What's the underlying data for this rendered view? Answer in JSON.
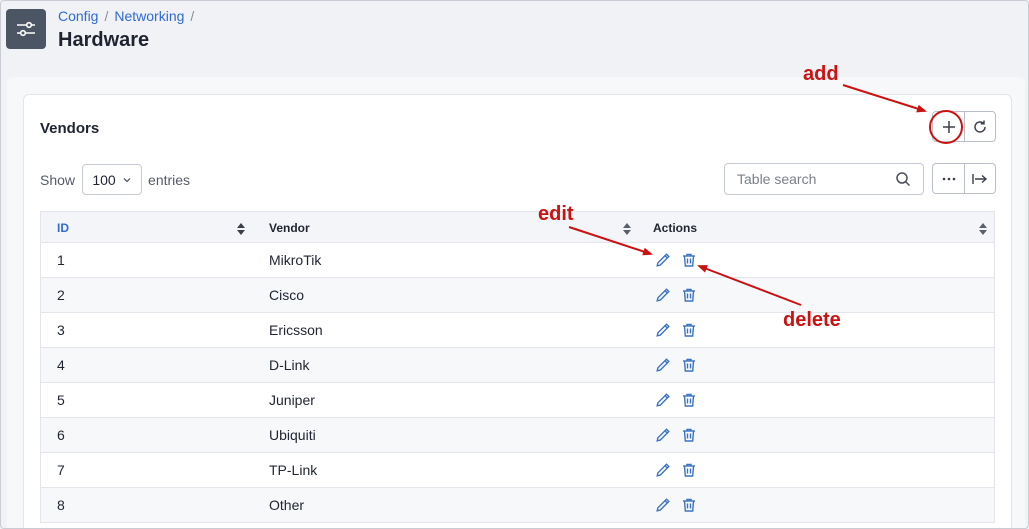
{
  "breadcrumb": {
    "item1": "Config",
    "sep1": "/",
    "item2": "Networking",
    "sep2": "/"
  },
  "page": {
    "title": "Hardware",
    "icon": "sliders-icon"
  },
  "card": {
    "title": "Vendors"
  },
  "toolbar": {
    "add_icon": "plus-icon",
    "refresh_icon": "refresh-icon",
    "more_icon": "ellipsis-icon",
    "export_icon": "arrow-to-right-icon"
  },
  "entries": {
    "show_label": "Show",
    "value": "100",
    "suffix": "entries"
  },
  "search": {
    "placeholder": "Table search"
  },
  "table": {
    "headers": {
      "id": "ID",
      "vendor": "Vendor",
      "actions": "Actions"
    },
    "rows": [
      {
        "id": "1",
        "vendor": "MikroTik"
      },
      {
        "id": "2",
        "vendor": "Cisco"
      },
      {
        "id": "3",
        "vendor": "Ericsson"
      },
      {
        "id": "4",
        "vendor": "D-Link"
      },
      {
        "id": "5",
        "vendor": "Juniper"
      },
      {
        "id": "6",
        "vendor": "Ubiquiti"
      },
      {
        "id": "7",
        "vendor": "TP-Link"
      },
      {
        "id": "8",
        "vendor": "Other"
      }
    ]
  },
  "annotations": {
    "add": "add",
    "edit": "edit",
    "delete": "delete"
  },
  "colors": {
    "link": "#2f6ad8",
    "annotation": "#cc1111",
    "icon_blue": "#3b73c4"
  }
}
